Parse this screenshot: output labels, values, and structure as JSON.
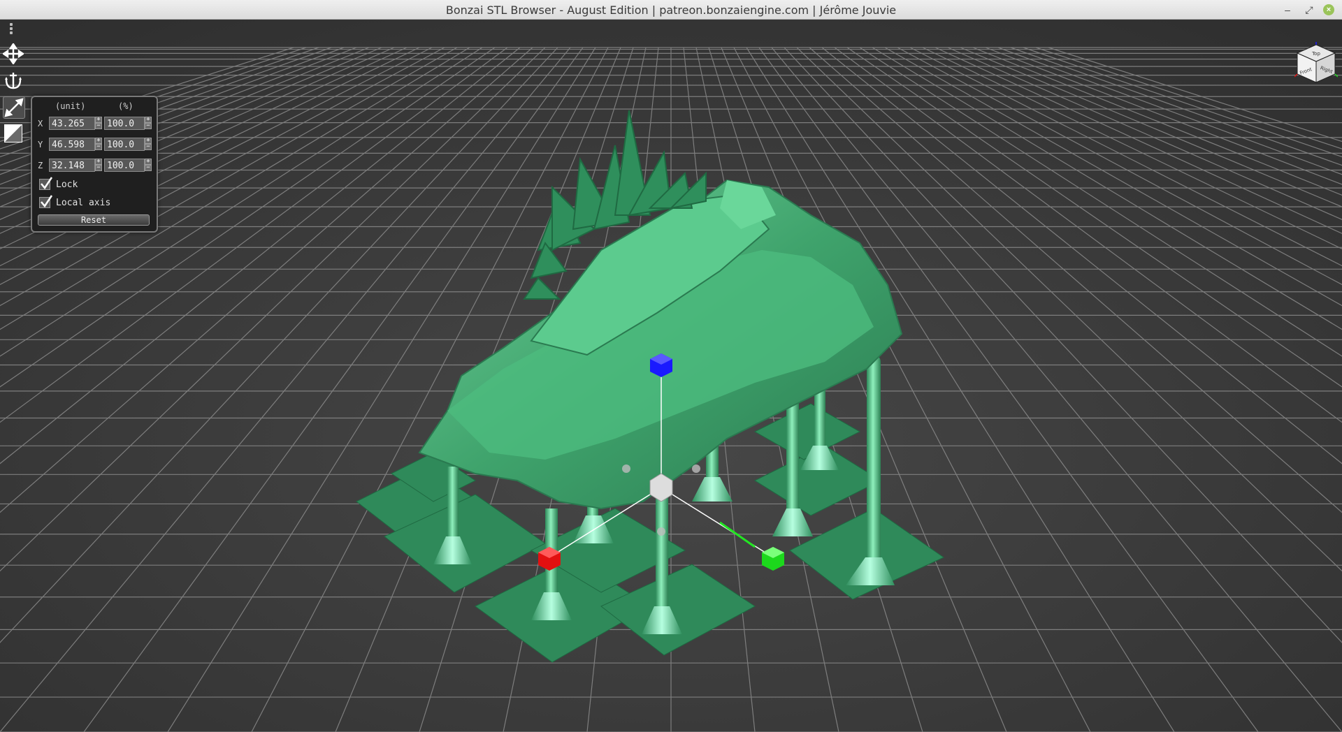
{
  "window": {
    "title": "Bonzai STL Browser - August Edition | patreon.bonzaiengine.com | Jérôme Jouvie",
    "controls": {
      "minimize": "–",
      "maximize": "⤢",
      "close": "×"
    }
  },
  "toolbar": {
    "tools": [
      {
        "name": "move-tool",
        "icon": "move-arrows-icon",
        "active": false
      },
      {
        "name": "rotate-tool",
        "icon": "anchor-rotate-icon",
        "active": false
      },
      {
        "name": "scale-tool",
        "icon": "scale-diagonal-icon",
        "active": true
      },
      {
        "name": "shade-tool",
        "icon": "half-shade-icon",
        "active": false
      }
    ]
  },
  "scale_panel": {
    "header_unit": "(unit)",
    "header_percent": "(%)",
    "rows": [
      {
        "axis": "X",
        "unit_value": "43.265",
        "percent_value": "100.0"
      },
      {
        "axis": "Y",
        "unit_value": "46.598",
        "percent_value": "100.0"
      },
      {
        "axis": "Z",
        "unit_value": "32.148",
        "percent_value": "100.0"
      }
    ],
    "lock_label": "Lock",
    "lock_checked": true,
    "local_axis_label": "Local axis",
    "local_axis_checked": true,
    "reset_label": "Reset"
  },
  "nav_cube": {
    "faces": [
      "Top",
      "Front",
      "Right"
    ]
  },
  "colors": {
    "background": "#3b3b3b",
    "grid": "#8a8a8a",
    "model": "#3fa36c",
    "gizmo_x": "#ff1e1e",
    "gizmo_y": "#22e622",
    "gizmo_z": "#1a1aff"
  }
}
